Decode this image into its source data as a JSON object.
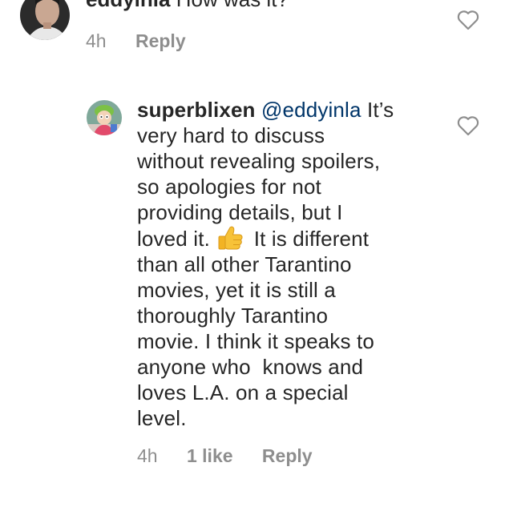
{
  "parent_comment": {
    "username": "eddyinla",
    "text": "How was it?",
    "time": "4h",
    "reply_label": "Reply",
    "avatar_icon": "user-avatar-photo",
    "like_icon": "heart-outline-icon"
  },
  "reply_comment": {
    "username": "superblixen",
    "mention": "@eddyinla",
    "lines": {
      "l1_tail": "It’s",
      "l2": "very hard to discuss",
      "l3": "without revealing spoilers,",
      "l4": "so apologies for not",
      "l5": "providing details, but I",
      "l6_before_emoji": "loved it.",
      "l6_after_emoji": "It is different",
      "l7": "than all other Tarantino",
      "l8": "movies, yet it is still a",
      "l9": "thoroughly Tarantino",
      "l10": "movie. I think it speaks to",
      "l11": "anyone who  knows and",
      "l12": "loves L.A. on a special",
      "l13": "level."
    },
    "emoji": "thumbs-up-emoji",
    "time": "4h",
    "likes": "1 like",
    "reply_label": "Reply",
    "avatar_icon": "cartoon-avatar",
    "like_icon": "heart-outline-icon"
  },
  "colors": {
    "text": "#262626",
    "meta": "#8e8e8e",
    "mention": "#003569"
  }
}
